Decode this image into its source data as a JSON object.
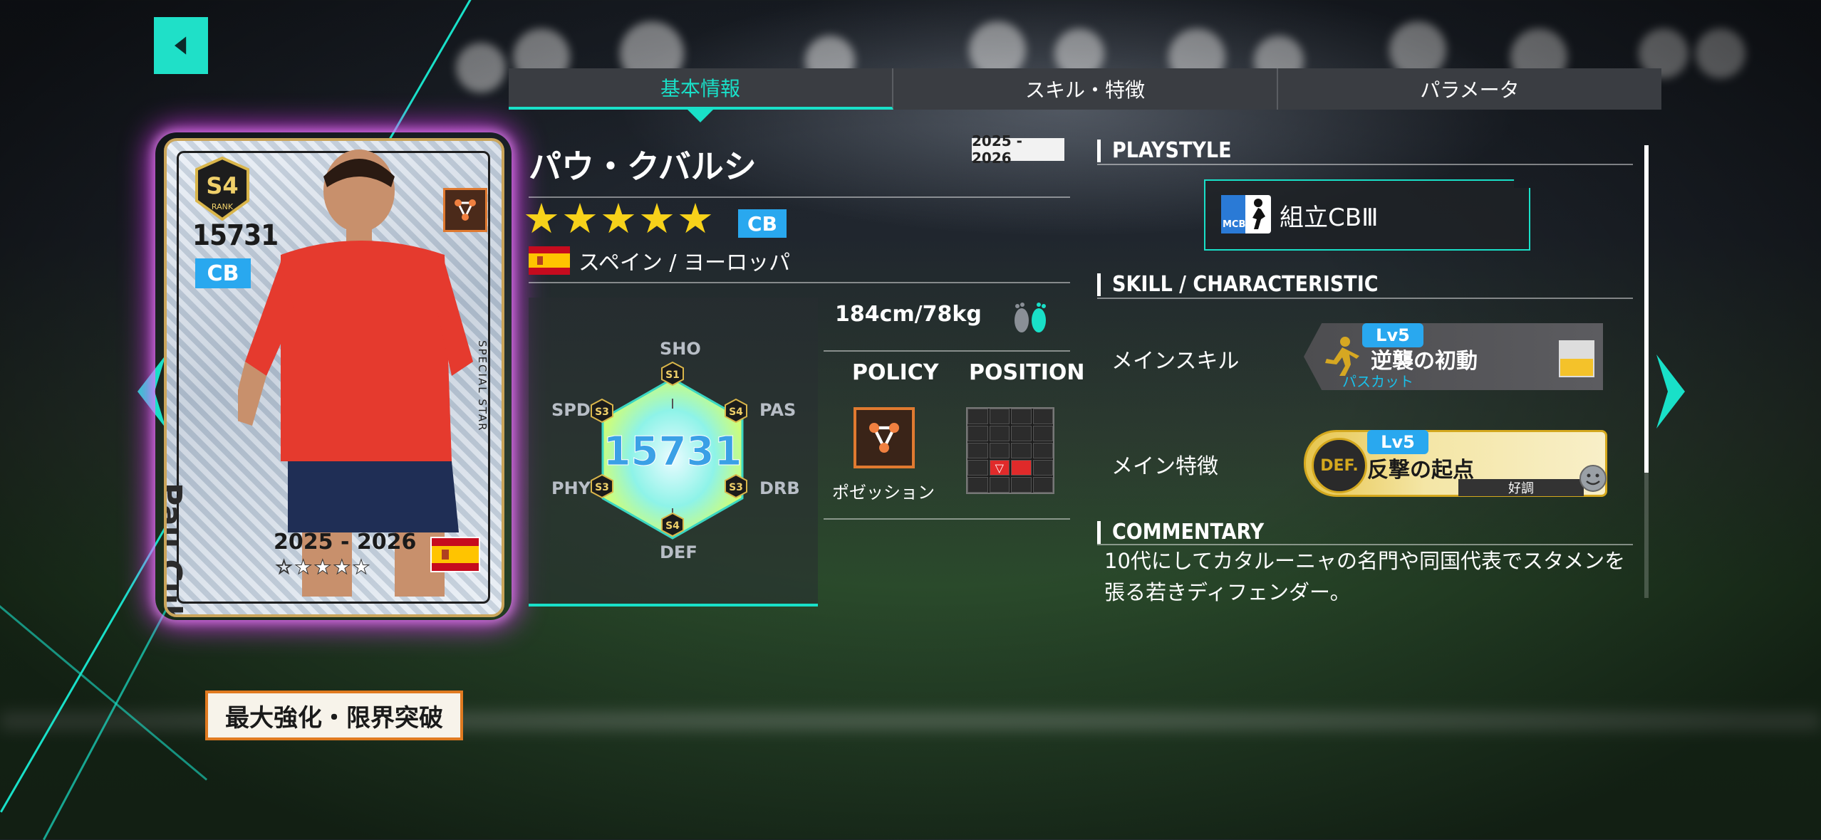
{
  "colors": {
    "accent": "#19e0c8",
    "position_blue": "#29a8ef",
    "star_gold": "#f7d21a",
    "policy_orange": "#e07a30",
    "card_glow": "#e63cff"
  },
  "navigation": {
    "back_icon": "back-arrow-icon",
    "prev_icon": "chevron-left-icon",
    "next_icon": "chevron-right-icon"
  },
  "tabs": [
    {
      "label": "基本情報",
      "active": true
    },
    {
      "label": "スキル・特徴",
      "active": false
    },
    {
      "label": "パラメータ",
      "active": false
    }
  ],
  "card": {
    "rank": "S4",
    "rank_label": "RANK",
    "rating": "15731",
    "position": "CB",
    "name": "Pau Cubarsí",
    "special_text": "SPECIAL STAR",
    "season": "2025 - 2026",
    "stars": "☆★★★★",
    "flag": "Spain"
  },
  "limit_button": "最大強化・限界突破",
  "player": {
    "name": "パウ・クバルシ",
    "season": "2025 - 2026",
    "stars": "★★★★★",
    "position": "CB",
    "nation": "スペイン / ヨーロッパ",
    "height_weight": "184cm/78kg"
  },
  "stats": {
    "total": "15731",
    "SHO": {
      "label": "SHO",
      "rank": "S1"
    },
    "PAS": {
      "label": "PAS",
      "rank": "S4"
    },
    "DRB": {
      "label": "DRB",
      "rank": "S3"
    },
    "DEF": {
      "label": "DEF",
      "rank": "S4"
    },
    "PHY": {
      "label": "PHY",
      "rank": "S3"
    },
    "SPD": {
      "label": "SPD",
      "rank": "S3"
    }
  },
  "policy": {
    "heading": "POLICY",
    "label": "ポゼッション",
    "icon": "possession-triangle-icon"
  },
  "position_map": {
    "heading": "POSITION",
    "marker": "▽"
  },
  "playstyle": {
    "title": "PLAYSTYLE",
    "icon_text": "MCB",
    "label": "組立CBⅢ"
  },
  "skills": {
    "title": "SKILL / CHARACTERISTIC",
    "main_skill_label": "メインスキル",
    "main_skill": {
      "level": "Lv5",
      "name": "逆襲の初動",
      "type": "パスカット"
    },
    "main_trait_label": "メイン特徴",
    "main_trait": {
      "level": "Lv5",
      "emblem": "DEF.",
      "name": "反撃の起点",
      "condition": "好調"
    }
  },
  "commentary": {
    "title": "COMMENTARY",
    "text": "10代にしてカタルーニャの名門や同国代表でスタメンを張る若きディフェンダー。"
  }
}
